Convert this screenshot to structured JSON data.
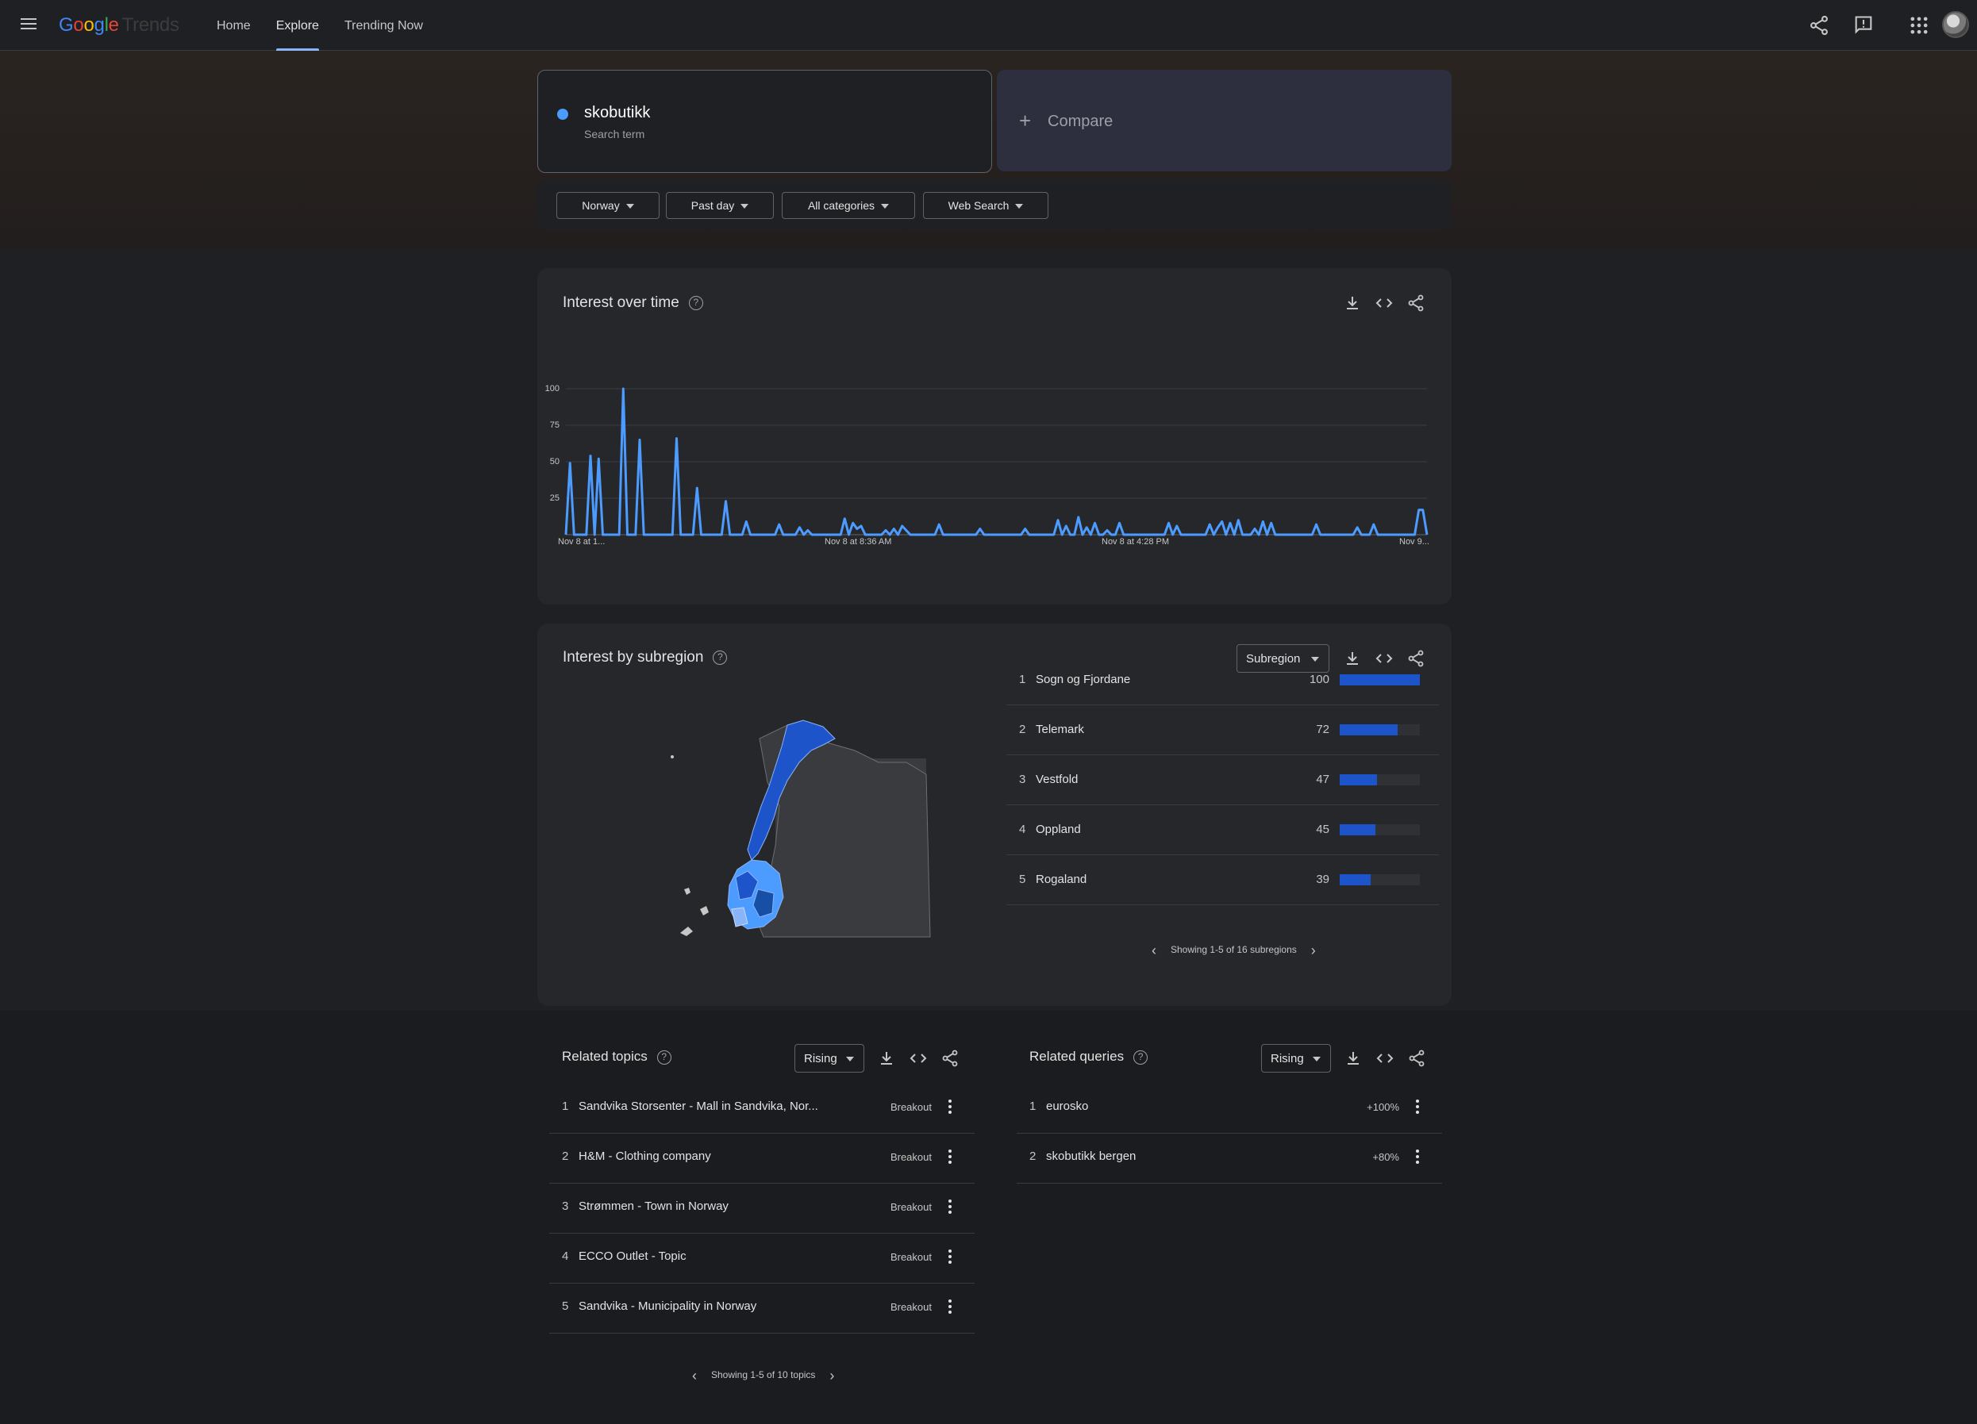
{
  "header": {
    "logo": {
      "g": "G",
      "o1": "o",
      "o2": "o",
      "g2": "g",
      "l": "l",
      "e": "e",
      "trends": "Trends"
    },
    "nav": [
      "Home",
      "Explore",
      "Trending Now"
    ],
    "active_nav": "Explore",
    "icons": [
      "share-icon",
      "feedback-icon",
      "apps-icon",
      "account-avatar"
    ]
  },
  "search": {
    "term": "skobutikk",
    "term_type": "Search term",
    "compare_label": "Compare",
    "term_color": "#4c9bff"
  },
  "filters": {
    "region": "Norway",
    "time": "Past day",
    "category": "All categories",
    "property": "Web Search"
  },
  "interest_over_time": {
    "title": "Interest over time"
  },
  "chart_data": {
    "type": "line",
    "title": "Interest over time",
    "xlabel": "",
    "ylabel": "",
    "ylim": [
      0,
      100
    ],
    "y_ticks": [
      "25",
      "50",
      "75",
      "100"
    ],
    "x_tick_labels": [
      "Nov 8 at 1...",
      "Nov 8 at 8:36 AM",
      "Nov 8 at 4:28 PM",
      "Nov 9..."
    ],
    "grid": true,
    "series": [
      {
        "color": "#4c9bff",
        "values": [
          0,
          49,
          0,
          0,
          0,
          0,
          54,
          0,
          52,
          0,
          0,
          0,
          0,
          0,
          100,
          0,
          0,
          0,
          65,
          0,
          0,
          0,
          0,
          0,
          0,
          0,
          0,
          66,
          0,
          0,
          0,
          0,
          32,
          0,
          0,
          0,
          0,
          0,
          0,
          23,
          0,
          0,
          0,
          0,
          9,
          0,
          0,
          0,
          0,
          0,
          0,
          0,
          7,
          0,
          0,
          0,
          0,
          5,
          0,
          3,
          0,
          0,
          0,
          0,
          0,
          0,
          0,
          0,
          11,
          0,
          8,
          4,
          6,
          0,
          0,
          0,
          0,
          0,
          3,
          0,
          4,
          0,
          6,
          3,
          0,
          0,
          0,
          0,
          0,
          0,
          0,
          7,
          0,
          0,
          0,
          0,
          0,
          0,
          0,
          0,
          0,
          4,
          0,
          0,
          0,
          0,
          0,
          0,
          0,
          0,
          0,
          0,
          4,
          0,
          0,
          0,
          0,
          0,
          0,
          0,
          10,
          0,
          6,
          0,
          0,
          12,
          0,
          5,
          0,
          8,
          0,
          0,
          3,
          0,
          0,
          8,
          0,
          0,
          0,
          0,
          0,
          0,
          0,
          0,
          0,
          0,
          0,
          8,
          0,
          6,
          0,
          0,
          0,
          0,
          0,
          0,
          0,
          7,
          0,
          5,
          9,
          0,
          8,
          0,
          10,
          0,
          0,
          0,
          4,
          0,
          9,
          0,
          8,
          0,
          0,
          0,
          0,
          0,
          0,
          0,
          0,
          0,
          0,
          7,
          0,
          0,
          0,
          0,
          0,
          0,
          0,
          0,
          0,
          5,
          0,
          0,
          0,
          7,
          0,
          0,
          0,
          0,
          0,
          0,
          0,
          0,
          0,
          0,
          17,
          17,
          0
        ]
      }
    ]
  },
  "subregion": {
    "title": "Interest by subregion",
    "dropdown": "Subregion",
    "rows": [
      {
        "rank": "1",
        "name": "Sogn og Fjordane",
        "value": "100",
        "fraction": 1.0
      },
      {
        "rank": "2",
        "name": "Telemark",
        "value": "72",
        "fraction": 0.72
      },
      {
        "rank": "3",
        "name": "Vestfold",
        "value": "47",
        "fraction": 0.47
      },
      {
        "rank": "4",
        "name": "Oppland",
        "value": "45",
        "fraction": 0.45
      },
      {
        "rank": "5",
        "name": "Rogaland",
        "value": "39",
        "fraction": 0.39
      }
    ],
    "pager": "Showing 1-5 of 16 subregions",
    "map_colors": {
      "norway_dark": "#1e54c9",
      "norway_mid": "#4c9bff",
      "norway_light": "#8ab4f8",
      "neighbors": "#3a3b3e"
    }
  },
  "related_topics": {
    "title": "Related topics",
    "dropdown": "Rising",
    "rows": [
      {
        "rank": "1",
        "name": "Sandvika Storsenter - Mall in Sandvika, Nor...",
        "value": "Breakout"
      },
      {
        "rank": "2",
        "name": "H&M - Clothing company",
        "value": "Breakout"
      },
      {
        "rank": "3",
        "name": "Strømmen - Town in Norway",
        "value": "Breakout"
      },
      {
        "rank": "4",
        "name": "ECCO Outlet - Topic",
        "value": "Breakout"
      },
      {
        "rank": "5",
        "name": "Sandvika - Municipality in Norway",
        "value": "Breakout"
      }
    ],
    "pager": "Showing 1-5 of 10 topics"
  },
  "related_queries": {
    "title": "Related queries",
    "dropdown": "Rising",
    "rows": [
      {
        "rank": "1",
        "name": "eurosko",
        "value": "+100%"
      },
      {
        "rank": "2",
        "name": "skobutikk bergen",
        "value": "+80%"
      }
    ]
  }
}
